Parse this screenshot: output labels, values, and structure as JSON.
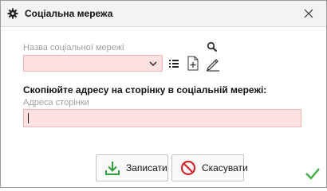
{
  "window": {
    "title": "Соціальна мережа",
    "icons": {
      "title": "gear-icon",
      "close": "close-icon"
    }
  },
  "network_field": {
    "label": "Назва соціальної мережі",
    "value": "",
    "icons": {
      "search": "search-icon",
      "dropdown": "chevron-down-icon",
      "list": "list-icon",
      "add": "add-document-icon",
      "edit": "pencil-icon"
    }
  },
  "address_section": {
    "heading": "Скопіюйте адресу на сторінку в соціальній мережі:",
    "label": "Адреса сторінки",
    "value": ""
  },
  "buttons": {
    "save_label": "Записати",
    "cancel_label": "Скасувати",
    "icons": {
      "save": "download-icon",
      "cancel": "cancel-icon",
      "status": "checkmark-icon"
    }
  },
  "colors": {
    "required_field_bg": "#fde0e0",
    "save_icon": "#2e9e3e",
    "cancel_icon": "#d3262c",
    "status_check": "#3cb043"
  }
}
